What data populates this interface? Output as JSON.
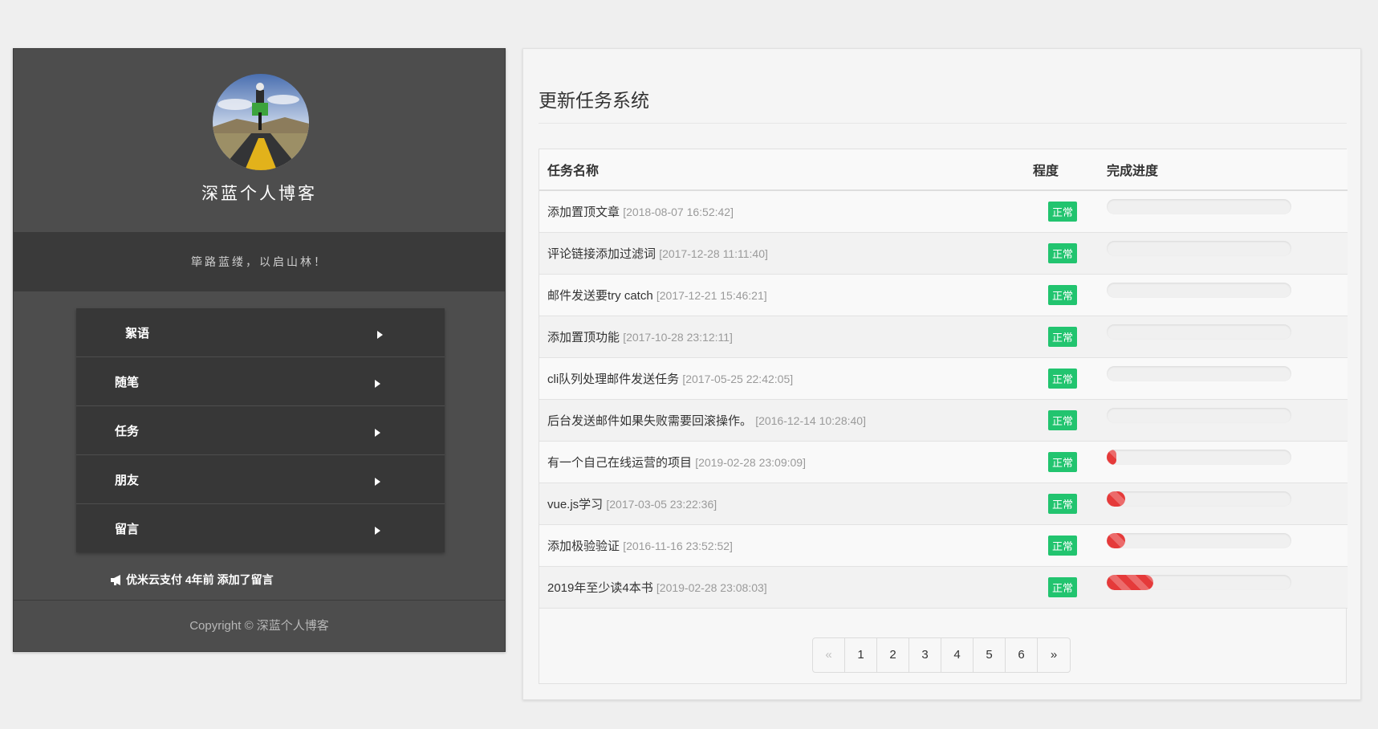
{
  "sidebar": {
    "site_title": "深蓝个人博客",
    "motto": "筚路蓝缕，以启山林！",
    "nav": [
      {
        "label": "絮语",
        "icon": "caret-right-icon"
      },
      {
        "label": "随笔",
        "icon": "caret-right-icon"
      },
      {
        "label": "任务",
        "icon": "caret-right-icon"
      },
      {
        "label": "朋友",
        "icon": "caret-right-icon"
      },
      {
        "label": "留言",
        "icon": "caret-right-icon"
      }
    ],
    "notice": {
      "icon": "bullhorn-icon",
      "text": "优米云支付 4年前 添加了留言"
    },
    "footer": "Copyright © 深蓝个人博客"
  },
  "main": {
    "title": "更新任务系统",
    "columns": {
      "name": "任务名称",
      "status": "程度",
      "progress": "完成进度"
    },
    "tasks": [
      {
        "name": "添加置顶文章",
        "time": "[2018-08-07 16:52:42]",
        "status": "正常",
        "progress": 0
      },
      {
        "name": "评论链接添加过滤词",
        "time": "[2017-12-28 11:11:40]",
        "status": "正常",
        "progress": 0
      },
      {
        "name": "邮件发送要try catch",
        "time": "[2017-12-21 15:46:21]",
        "status": "正常",
        "progress": 0
      },
      {
        "name": "添加置顶功能",
        "time": "[2017-10-28 23:12:11]",
        "status": "正常",
        "progress": 0
      },
      {
        "name": "cli队列处理邮件发送任务",
        "time": "[2017-05-25 22:42:05]",
        "status": "正常",
        "progress": 0
      },
      {
        "name": "后台发送邮件如果失败需要回滚操作。",
        "time": "[2016-12-14 10:28:40]",
        "status": "正常",
        "progress": 0
      },
      {
        "name": "有一个自己在线运营的项目",
        "time": "[2019-02-28 23:09:09]",
        "status": "正常",
        "progress": 5
      },
      {
        "name": "vue.js学习",
        "time": "[2017-03-05 23:22:36]",
        "status": "正常",
        "progress": 10
      },
      {
        "name": "添加极验验证",
        "time": "[2016-11-16 23:52:52]",
        "status": "正常",
        "progress": 10
      },
      {
        "name": "2019年至少读4本书",
        "time": "[2019-02-28 23:08:03]",
        "status": "正常",
        "progress": 25
      }
    ],
    "pagination": {
      "prev": "«",
      "pages": [
        "1",
        "2",
        "3",
        "4",
        "5",
        "6"
      ],
      "next": "»"
    }
  },
  "colors": {
    "badge": "#22c46f",
    "progress_bar": "#e53a3a",
    "sidebar_bg": "#4d4d4d"
  }
}
